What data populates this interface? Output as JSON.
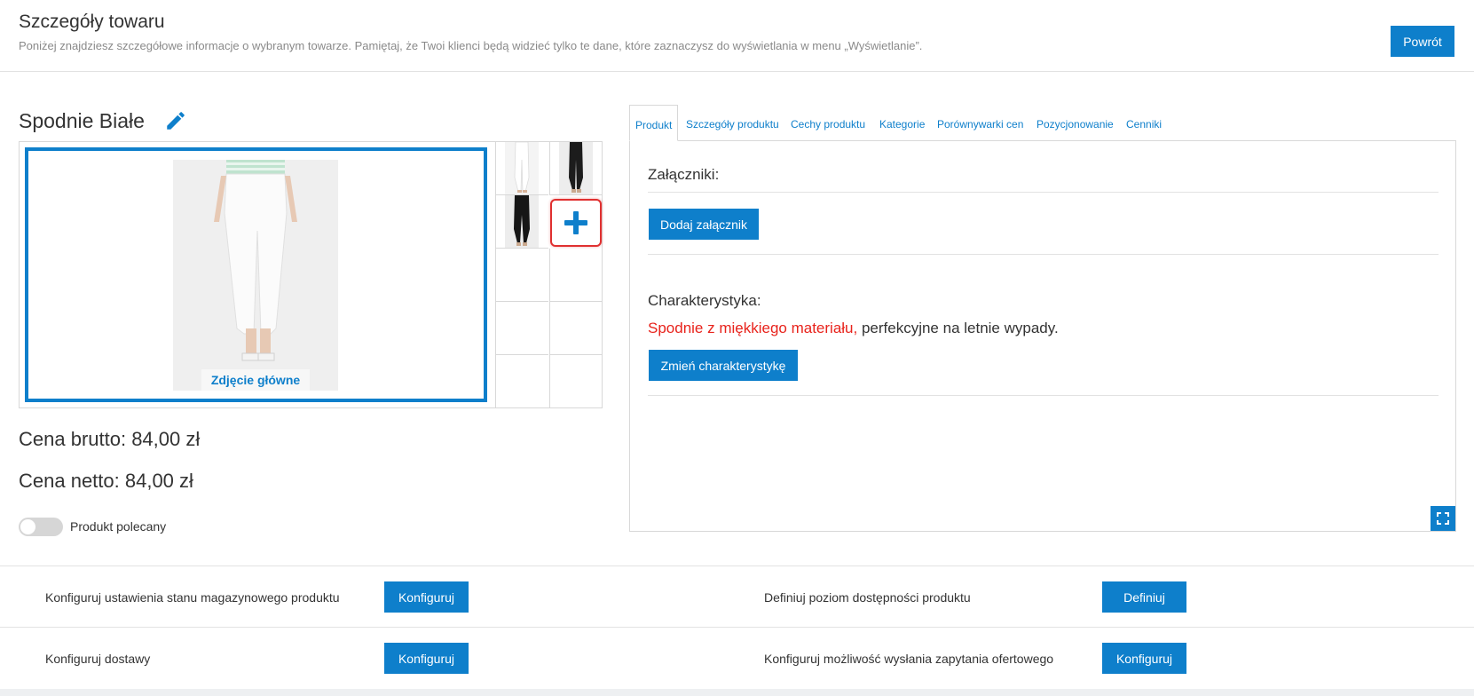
{
  "header": {
    "title": "Szczegóły towaru",
    "subtitle": "Poniżej znajdziesz szczegółowe informacje o wybranym towarze. Pamiętaj, że Twoi klienci będą widzieć tylko te dane, które zaznaczysz do wyświetlania w menu „Wyświetlanie”.",
    "back_label": "Powrót"
  },
  "product": {
    "name": "Spodnie Białe",
    "main_photo_caption": "Zdjęcie główne",
    "price_gross": "Cena brutto: 84,00 zł",
    "price_net": "Cena netto: 84,00 zł",
    "featured_label": "Produkt polecany",
    "featured_on": false
  },
  "tabs": [
    "Produkt",
    "Szczegóły produktu",
    "Cechy produktu",
    "Kategorie",
    "Porównywarki cen",
    "Pozycjonowanie",
    "Cenniki"
  ],
  "panel": {
    "attachments_title": "Załączniki:",
    "add_attachment_label": "Dodaj załącznik",
    "characteristics_title": "Charakterystyka:",
    "description_red": "Spodnie z miękkiego materiału,",
    "description_rest": " perfekcyjne na letnie wypady.",
    "change_characteristics_label": "Zmień charakterystykę"
  },
  "config": {
    "stock_label": "Konfiguruj ustawienia stanu magazynowego produktu",
    "stock_btn": "Konfiguruj",
    "availability_label": "Definiuj poziom dostępności produktu",
    "availability_btn": "Definiuj",
    "delivery_label": "Konfiguruj dostawy",
    "delivery_btn": "Konfiguruj",
    "quote_label": "Konfiguruj możliwość wysłania zapytania ofertowego",
    "quote_btn": "Konfiguruj"
  },
  "colors": {
    "accent": "#0e7fcb",
    "highlight_red": "#e8231c",
    "add_photo_border": "#e03030"
  }
}
